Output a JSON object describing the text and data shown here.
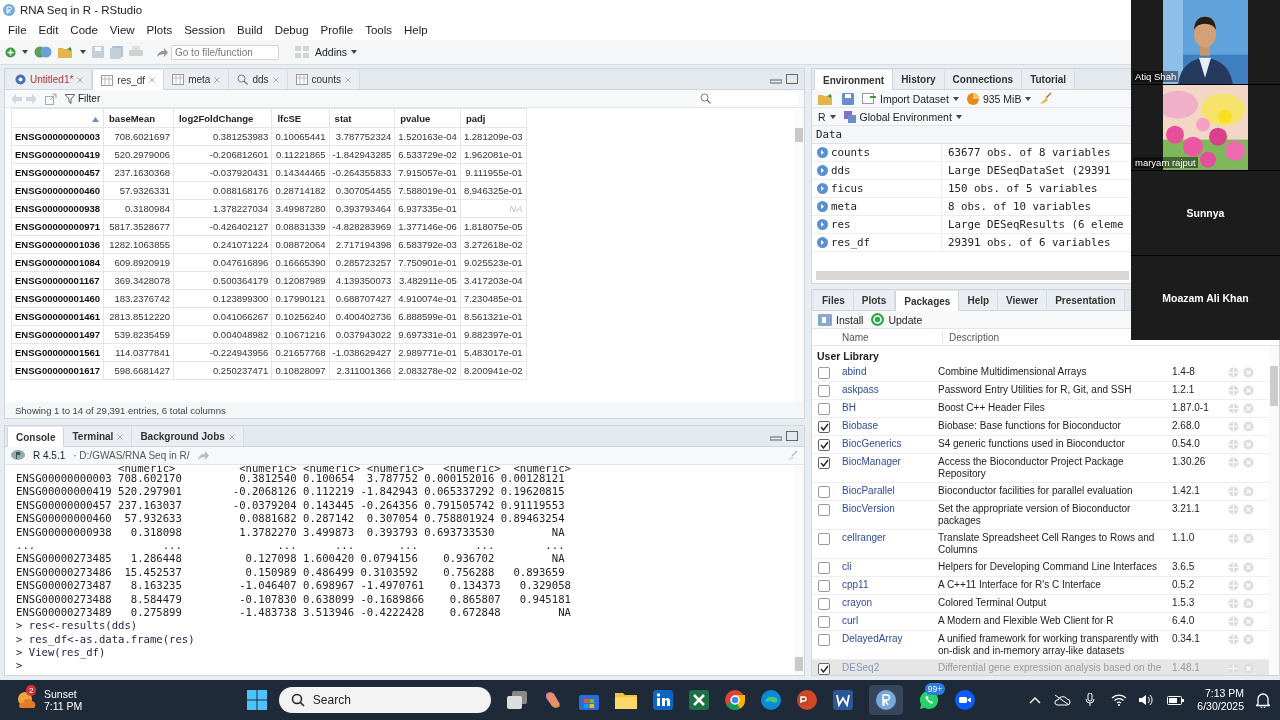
{
  "window": {
    "title": "RNA Seq in R - RStudio"
  },
  "menu": [
    "File",
    "Edit",
    "Code",
    "View",
    "Plots",
    "Session",
    "Build",
    "Debug",
    "Profile",
    "Tools",
    "Help"
  ],
  "toolbar": {
    "goto_placeholder": "Go to file/function",
    "addins": "Addins"
  },
  "source_tabs": [
    {
      "label": "Untitled1*",
      "kind": "script",
      "selected": false
    },
    {
      "label": "res_df",
      "kind": "table",
      "selected": true
    },
    {
      "label": "meta",
      "kind": "table",
      "selected": false
    },
    {
      "label": "dds",
      "kind": "search",
      "selected": false
    },
    {
      "label": "counts",
      "kind": "table",
      "selected": false
    }
  ],
  "filter": "Filter",
  "table": {
    "columns": [
      "",
      "baseMean",
      "log2FoldChange",
      "lfcSE",
      "stat",
      "pvalue",
      "padj"
    ],
    "rows": [
      [
        "ENSG00000000003",
        "708.6021697",
        "0.381253983",
        "0.10065441",
        "3.787752324",
        "1.520163e-04",
        "1.281209e-03"
      ],
      [
        "ENSG00000000419",
        "520.2979006",
        "-0.206812601",
        "0.11221865",
        "-1.842943285",
        "6.533729e-02",
        "1.962081e-01"
      ],
      [
        "ENSG00000000457",
        "237.1630368",
        "-0.037920431",
        "0.14344465",
        "-0.264355833",
        "7.915057e-01",
        "9.111955e-01"
      ],
      [
        "ENSG00000000460",
        "57.9326331",
        "0.088168176",
        "0.28714182",
        "0.307054455",
        "7.588019e-01",
        "8.946325e-01"
      ],
      [
        "ENSG00000000938",
        "0.3180984",
        "1.378227034",
        "3.49987280",
        "0.393793464",
        "6.937335e-01",
        "NA"
      ],
      [
        "ENSG00000000971",
        "5817.3528677",
        "-0.426402127",
        "0.08831339",
        "-4.828283969",
        "1.377146e-06",
        "1.818075e-05"
      ],
      [
        "ENSG00000001036",
        "1282.1063855",
        "0.241071224",
        "0.08872064",
        "2.717194398",
        "6.583792e-03",
        "3.272618e-02"
      ],
      [
        "ENSG00000001084",
        "609.8920919",
        "0.047616896",
        "0.16665390",
        "0.285723257",
        "7.750901e-01",
        "9.025523e-01"
      ],
      [
        "ENSG00000001167",
        "369.3428078",
        "0.500364179",
        "0.12087989",
        "4.139350073",
        "3.482911e-05",
        "3.417203e-04"
      ],
      [
        "ENSG00000001460",
        "183.2376742",
        "0.123899300",
        "0.17990121",
        "0.688707427",
        "4.910074e-01",
        "7.230485e-01"
      ],
      [
        "ENSG00000001461",
        "2813.8512220",
        "0.041066267",
        "0.10256240",
        "0.400402736",
        "6.888599e-01",
        "8.561321e-01"
      ],
      [
        "ENSG00000001497",
        "539.8235459",
        "0.004048982",
        "0.10671216",
        "0.037943022",
        "9.697331e-01",
        "9.882397e-01"
      ],
      [
        "ENSG00000001561",
        "114.0377841",
        "-0.224943956",
        "0.21657768",
        "-1.038629427",
        "2.989771e-01",
        "5.483017e-01"
      ],
      [
        "ENSG00000001617",
        "598.6681427",
        "0.250237471",
        "0.10828097",
        "2.311001366",
        "2.083278e-02",
        "8.200941e-02"
      ]
    ],
    "footer": "Showing 1 to 14 of 29,391 entries, 6 total columns"
  },
  "console_tabs": [
    {
      "label": "Console",
      "selected": true
    },
    {
      "label": "Terminal",
      "selected": false
    },
    {
      "label": "Background Jobs",
      "selected": false
    }
  ],
  "console": {
    "version": "R 4.5.1",
    "path": "· D:/GWAS/RNA Seq in R/",
    "lines": [
      "                <numeric>          <numeric> <numeric> <numeric>   <numeric>  <numeric>",
      "ENSG00000000003 708.602170         0.3812540 0.100654  3.787752 0.000152016 0.00128121",
      "ENSG00000000419 520.297901        -0.2068126 0.112219 -1.842943 0.065337292 0.19620815",
      "ENSG00000000457 237.163037        -0.0379204 0.143445 -0.264356 0.791505742 0.91119553",
      "ENSG00000000460  57.932633         0.0881682 0.287142  0.307054 0.758801924 0.89463254",
      "ENSG00000000938   0.318098         1.3782270 3.499873  0.393793 0.693733530         NA",
      "...                    ...               ...      ...       ...         ...        ...",
      "ENSG00000273485   1.286448          0.127098 1.600420 0.0794156    0.936702         NA",
      "ENSG00000273486  15.452537          0.150989 0.486499 0.3103592    0.756288   0.893659",
      "ENSG00000273487   8.163235         -1.046407 0.698967 -1.4970761    0.134373   0.329058",
      "ENSG00000273488   8.584479         -0.107830 0.638099 -0.1689866    0.865807   0.945181",
      "ENSG00000273489   0.275899         -1.483738 3.513946 -0.4222428    0.672848         NA",
      "> res<-results(dds)",
      "> res_df<-as.data.frame(res)",
      "> View(res_df)",
      ">"
    ]
  },
  "env_tabs": [
    {
      "label": "Environment",
      "selected": true
    },
    {
      "label": "History",
      "selected": false
    },
    {
      "label": "Connections",
      "selected": false
    },
    {
      "label": "Tutorial",
      "selected": false
    }
  ],
  "env_toolbar": {
    "import": "Import Dataset",
    "memory": "935 MiB",
    "language": "R",
    "scope": "Global Environment"
  },
  "env_section": "Data",
  "env_items": [
    {
      "name": "counts",
      "value": "63677 obs. of 8 variables"
    },
    {
      "name": "dds",
      "value": "Large DESeqDataSet (29391"
    },
    {
      "name": "ficus",
      "value": "150 obs. of 5 variables"
    },
    {
      "name": "meta",
      "value": "8 obs. of 10 variables"
    },
    {
      "name": "res",
      "value": "Large DESeqResults (6 eleme"
    },
    {
      "name": "res_df",
      "value": "29391 obs. of 6 variables"
    }
  ],
  "files_tabs": [
    {
      "label": "Files",
      "selected": false
    },
    {
      "label": "Plots",
      "selected": false
    },
    {
      "label": "Packages",
      "selected": true
    },
    {
      "label": "Help",
      "selected": false
    },
    {
      "label": "Viewer",
      "selected": false
    },
    {
      "label": "Presentation",
      "selected": false
    }
  ],
  "packages_toolbar": {
    "install": "Install",
    "update": "Update"
  },
  "packages_columns": [
    "Name",
    "Description"
  ],
  "library": "User Library",
  "packages": [
    {
      "checked": false,
      "faded": false,
      "name": "abind",
      "description": "Combine Multidimensional Arrays",
      "version": "1.4-8"
    },
    {
      "checked": false,
      "faded": false,
      "name": "askpass",
      "description": "Password Entry Utilities for R, Git, and SSH",
      "version": "1.2.1"
    },
    {
      "checked": false,
      "faded": false,
      "name": "BH",
      "description": "Boost C++ Header Files",
      "version": "1.87.0-1"
    },
    {
      "checked": true,
      "faded": false,
      "name": "Biobase",
      "description": "Biobase: Base functions for Bioconductor",
      "version": "2.68.0"
    },
    {
      "checked": true,
      "faded": false,
      "name": "BiocGenerics",
      "description": "S4 generic functions used in Bioconductor",
      "version": "0.54.0"
    },
    {
      "checked": true,
      "faded": false,
      "name": "BiocManager",
      "description": "Access the Bioconductor Project Package Repository",
      "version": "1.30.26"
    },
    {
      "checked": false,
      "faded": false,
      "name": "BiocParallel",
      "description": "Bioconductor facilities for parallel evaluation",
      "version": "1.42.1"
    },
    {
      "checked": false,
      "faded": false,
      "name": "BiocVersion",
      "description": "Set the appropriate version of Bioconductor packages",
      "version": "3.21.1"
    },
    {
      "checked": false,
      "faded": false,
      "name": "cellranger",
      "description": "Translate Spreadsheet Cell Ranges to Rows and Columns",
      "version": "1.1.0"
    },
    {
      "checked": false,
      "faded": false,
      "name": "cli",
      "description": "Helpers for Developing Command Line Interfaces",
      "version": "3.6.5"
    },
    {
      "checked": false,
      "faded": false,
      "name": "cpp11",
      "description": "A C++11 Interface for R's C Interface",
      "version": "0.5.2"
    },
    {
      "checked": false,
      "faded": false,
      "name": "crayon",
      "description": "Colored Terminal Output",
      "version": "1.5.3"
    },
    {
      "checked": false,
      "faded": false,
      "name": "curl",
      "description": "A Modern and Flexible Web Client for R",
      "version": "6.4.0"
    },
    {
      "checked": false,
      "faded": false,
      "name": "DelayedArray",
      "description": "A unified framework for working transparently with on-disk and in-memory array-like datasets",
      "version": "0.34.1"
    },
    {
      "checked": true,
      "faded": true,
      "name": "DESeq2",
      "description": "Differential gene expression analysis based on the",
      "version": "1.48.1"
    }
  ],
  "participants": [
    {
      "name": "Atiq Shah",
      "kind": "person"
    },
    {
      "name": "maryam rajput",
      "kind": "picture"
    },
    {
      "name": "Sunnya",
      "kind": "none"
    },
    {
      "name": "Moazam Ali Khan",
      "kind": "none"
    }
  ],
  "taskbar": {
    "weather": "Sunset",
    "weather_time": "7:11 PM",
    "weather_badge": "2",
    "search": "Search",
    "chat_badge": "99+",
    "time": "7:13 PM",
    "date": "6/30/2025"
  }
}
